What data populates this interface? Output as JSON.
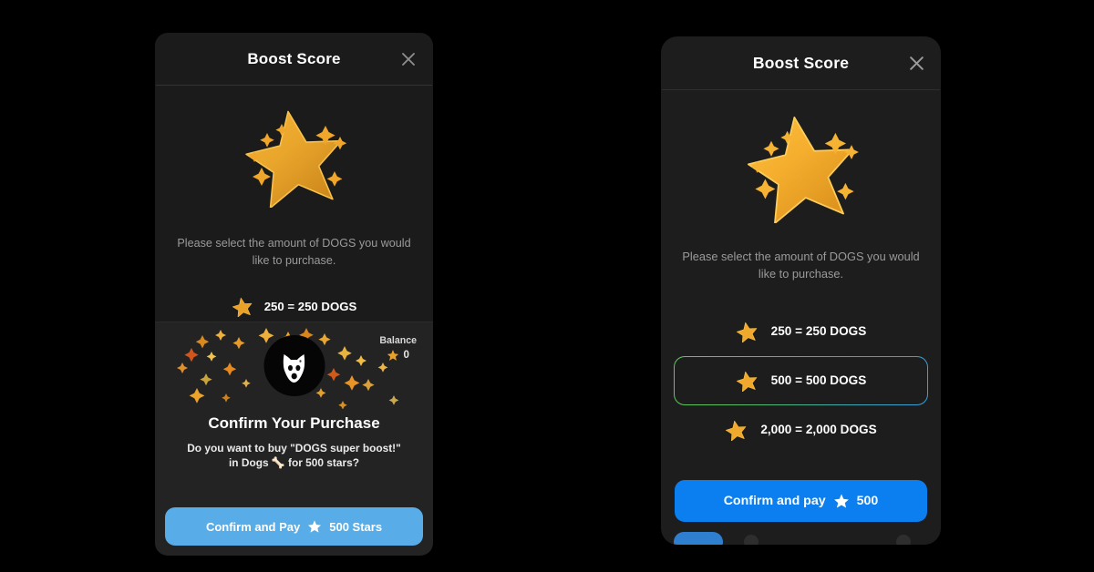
{
  "background_color": "#000000",
  "panels": {
    "left": {
      "header": {
        "title": "Boost Score",
        "close_icon": "close-icon"
      },
      "hero_icon": "gold-star-icon",
      "description": "Please select the amount of DOGS you would like to purchase.",
      "option": {
        "star_icon": "gold-star-icon",
        "label": "250 = 250 DOGS"
      },
      "confirm_overlay": {
        "logo_icon": "dogs-logo-icon",
        "balance_label": "Balance",
        "balance_star_icon": "gold-star-icon",
        "balance_value": "0",
        "title": "Confirm Your Purchase",
        "subtitle_line1": "Do you want to buy \"DOGS super boost!\"",
        "subtitle_line2": "in Dogs 🦴 for 500 stars?"
      },
      "pay_button": {
        "text_before": "Confirm and Pay",
        "star_icon": "white-star-icon",
        "text_after": "500 Stars",
        "color": "#58ade8"
      }
    },
    "right": {
      "header": {
        "title": "Boost Score",
        "close_icon": "close-icon"
      },
      "hero_icon": "gold-star-icon",
      "description": "Please select the amount of DOGS you would like to purchase.",
      "options": [
        {
          "star_icon": "gold-star-icon",
          "label": "250 = 250 DOGS",
          "selected": false
        },
        {
          "star_icon": "gold-star-icon",
          "label": "500 = 500 DOGS",
          "selected": true
        },
        {
          "star_icon": "gold-star-icon",
          "label": "2,000 = 2,000 DOGS",
          "selected": false
        }
      ],
      "selected_border_gradient": {
        "from": "#5ec85e",
        "to": "#3a9fd8"
      },
      "pay_button": {
        "text_before": "Confirm and pay",
        "star_icon": "white-star-icon",
        "text_after": "500",
        "color": "#0b7ef0"
      }
    }
  }
}
